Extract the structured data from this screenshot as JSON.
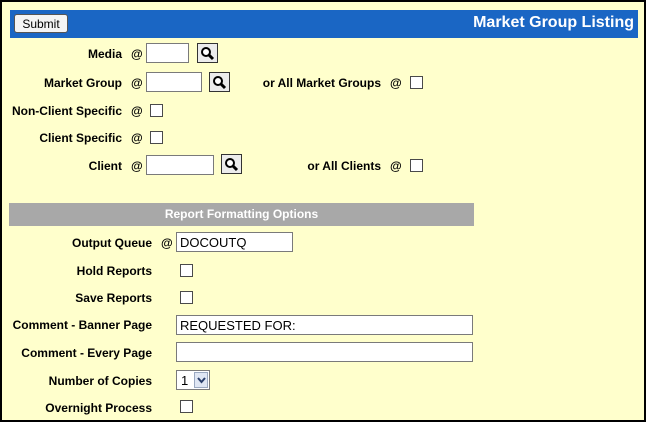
{
  "header": {
    "submit_label": "Submit",
    "title": "Market Group Listing"
  },
  "criteria": {
    "media": {
      "label": "Media",
      "at": "@",
      "value": "",
      "lookup_icon": "magnifier-icon"
    },
    "market_group": {
      "label": "Market Group",
      "at": "@",
      "value": "",
      "lookup_icon": "magnifier-icon",
      "all_label": "or All Market Groups",
      "all_at": "@",
      "all_checked": false
    },
    "non_client_specific": {
      "label": "Non-Client Specific",
      "at": "@",
      "checked": false
    },
    "client_specific": {
      "label": "Client Specific",
      "at": "@",
      "checked": false
    },
    "client": {
      "label": "Client",
      "at": "@",
      "value": "",
      "lookup_icon": "magnifier-icon",
      "all_label": "or All Clients",
      "all_at": "@",
      "all_checked": false
    }
  },
  "report_options": {
    "section_title": "Report Formatting Options",
    "output_queue": {
      "label": "Output Queue",
      "at": "@",
      "value": "DOCOUTQ"
    },
    "hold_reports": {
      "label": "Hold Reports",
      "checked": false
    },
    "save_reports": {
      "label": "Save Reports",
      "checked": false
    },
    "comment_banner": {
      "label": "Comment - Banner Page",
      "value": "REQUESTED FOR:"
    },
    "comment_every": {
      "label": "Comment - Every Page",
      "value": ""
    },
    "copies": {
      "label": "Number of Copies",
      "value": "1"
    },
    "overnight": {
      "label": "Overnight Process",
      "checked": false
    }
  },
  "colors": {
    "title_bar": "#1a66c4",
    "background": "#ffffcc",
    "section_header": "#a8a8a8"
  }
}
